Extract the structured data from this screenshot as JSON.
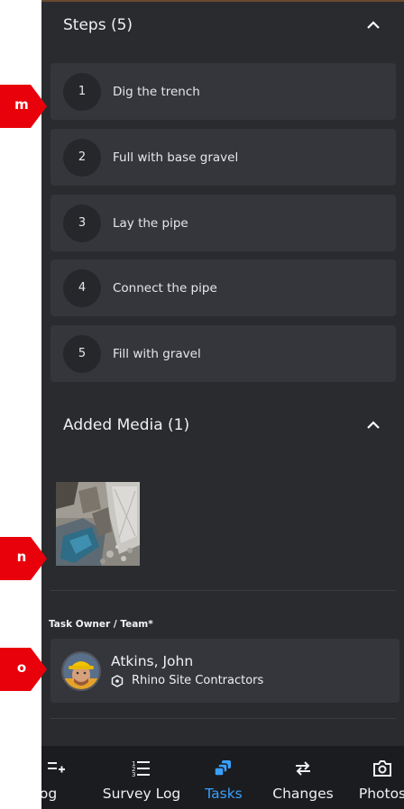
{
  "steps_section": {
    "title": "Steps (5)"
  },
  "steps": [
    {
      "number": "1",
      "label": "Dig the trench"
    },
    {
      "number": "2",
      "label": "Full with base gravel"
    },
    {
      "number": "3",
      "label": "Lay the pipe"
    },
    {
      "number": "4",
      "label": "Connect the pipe"
    },
    {
      "number": "5",
      "label": "Fill with gravel"
    }
  ],
  "media_section": {
    "title": "Added Media (1)"
  },
  "owner": {
    "field_label": "Task Owner / Team*",
    "name": "Atkins, John",
    "team": "Rhino Site Contractors"
  },
  "nav": [
    {
      "label": "Site Log",
      "icon": "add-list-icon",
      "active": false
    },
    {
      "label": "Survey Log",
      "icon": "list-icon",
      "active": false
    },
    {
      "label": "Tasks",
      "icon": "tasks-icon",
      "active": true
    },
    {
      "label": "Changes",
      "icon": "swap-arrows-icon",
      "active": false
    },
    {
      "label": "Photos",
      "icon": "camera-icon",
      "active": false
    }
  ],
  "markers": [
    {
      "label": "m"
    },
    {
      "label": "n"
    },
    {
      "label": "o"
    }
  ],
  "colors": {
    "panel_bg": "#2a2b2f",
    "card_bg": "#35363b",
    "nav_bg": "#1b1c1f",
    "active_accent": "#3aa0ff",
    "marker_red": "#e8000b"
  }
}
